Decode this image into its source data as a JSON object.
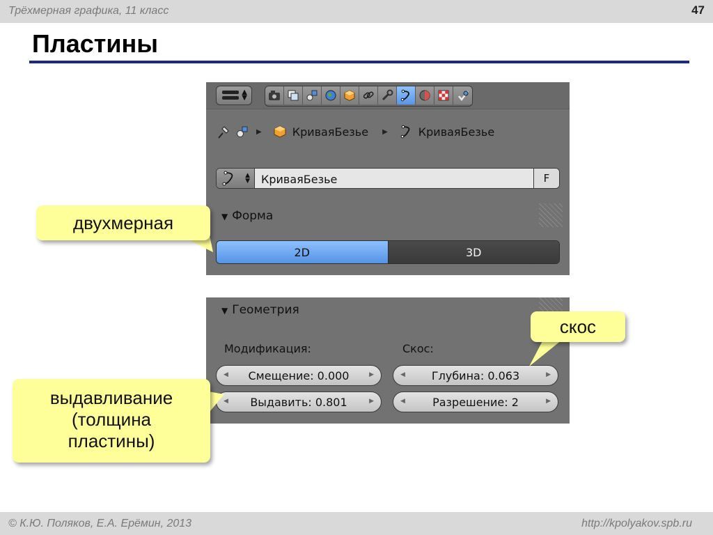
{
  "slide": {
    "course": "Трёхмерная графика, 11 класс",
    "page": "47",
    "title": "Пластины",
    "authors": "© К.Ю. Поляков, Е.А. Ерёмин, 2013",
    "url": "http://kpolyakov.spb.ru"
  },
  "panel1": {
    "tabs": [
      "render-icon",
      "scene-layers-icon",
      "scene-icon",
      "world-icon",
      "object-icon",
      "constraints-icon",
      "modifiers-icon",
      "curve-data-icon",
      "material-icon",
      "texture-icon",
      "physics-icon"
    ],
    "active_tab": 7,
    "breadcrumb": {
      "object": "КриваяБезье",
      "data": "КриваяБезье"
    },
    "datablock": {
      "name": "КриваяБезье",
      "fake_user": "F"
    },
    "shape": {
      "header": "Форма",
      "opt_2d": "2D",
      "opt_3d": "3D",
      "selected": "2D"
    }
  },
  "panel2": {
    "header": "Геометрия",
    "modification_label": "Модификация:",
    "bevel_label": "Скос:",
    "offset": "Смещение: 0.000",
    "extrude": "Выдавить: 0.801",
    "depth": "Глубина: 0.063",
    "resolution": "Разрешение: 2"
  },
  "callouts": {
    "twod": "двухмерная",
    "bevel": "скос",
    "extrude": [
      "выдавливание",
      "(толщина",
      "пластины)"
    ]
  },
  "colors": {
    "title_rule": "#1b2a8a",
    "callout": "#ffff99",
    "active_blue": "#5a96e6",
    "panel_bg": "#727272"
  }
}
